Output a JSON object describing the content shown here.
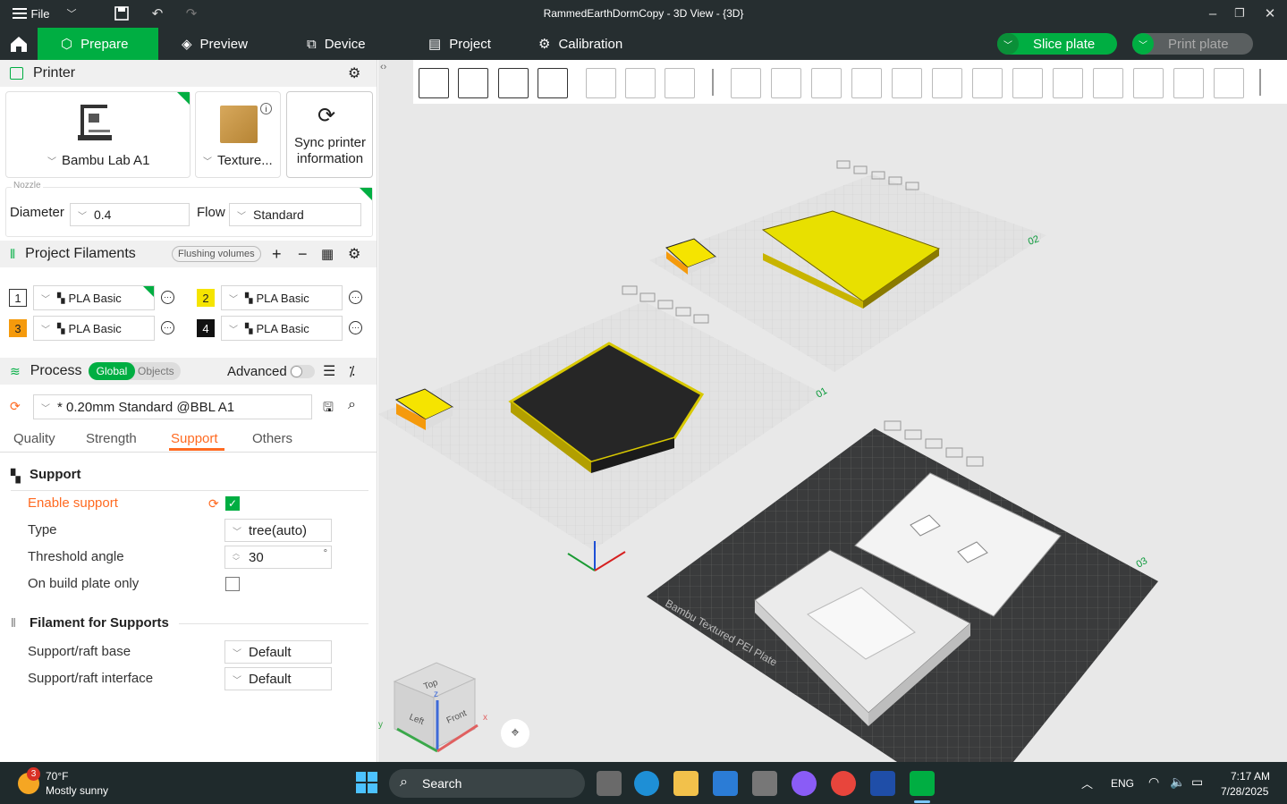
{
  "window": {
    "title": "RammedEarthDormCopy - 3D View - {3D}",
    "menu_label": "File"
  },
  "tabs": [
    {
      "label": "Prepare",
      "icon": "cube-icon",
      "active": true
    },
    {
      "label": "Preview",
      "icon": "layers-icon"
    },
    {
      "label": "Device",
      "icon": "device-icon"
    },
    {
      "label": "Project",
      "icon": "project-icon"
    },
    {
      "label": "Calibration",
      "icon": "calibration-icon"
    }
  ],
  "actions": {
    "slice": "Slice plate",
    "print": "Print plate"
  },
  "printer": {
    "section": "Printer",
    "name": "Bambu Lab A1",
    "plate": "Texture...",
    "sync": "Sync printer information",
    "nozzle_legend": "Nozzle",
    "diameter_label": "Diameter",
    "diameter_value": "0.4",
    "flow_label": "Flow",
    "flow_value": "Standard"
  },
  "filaments": {
    "section": "Project Filaments",
    "flushing": "Flushing volumes",
    "items": [
      {
        "num": "1",
        "name": "PLA Basic",
        "color": "#ffffff"
      },
      {
        "num": "2",
        "name": "PLA Basic",
        "color": "#f5e400"
      },
      {
        "num": "3",
        "name": "PLA Basic",
        "color": "#f59a0c"
      },
      {
        "num": "4",
        "name": "PLA Basic",
        "color": "#111111"
      }
    ]
  },
  "process": {
    "section": "Process",
    "global": "Global",
    "objects": "Objects",
    "advanced": "Advanced",
    "preset": "* 0.20mm Standard @BBL A1",
    "subtabs": [
      "Quality",
      "Strength",
      "Support",
      "Others"
    ],
    "active_subtab": "Support"
  },
  "support": {
    "title": "Support",
    "enable_label": "Enable support",
    "enable_checked": true,
    "type_label": "Type",
    "type_value": "tree(auto)",
    "threshold_label": "Threshold angle",
    "threshold_value": "30",
    "threshold_unit": "°",
    "build_plate_label": "On build plate only",
    "build_plate_checked": false,
    "filament_title": "Filament for Supports",
    "base_label": "Support/raft base",
    "base_value": "Default",
    "interface_label": "Support/raft interface",
    "interface_value": "Default"
  },
  "viewport": {
    "plate_labels": [
      "02",
      "01",
      "03"
    ],
    "cube_labels": {
      "top": "Top",
      "left": "Left",
      "front": "Front"
    },
    "axis_labels": {
      "x": "x",
      "y": "y",
      "z": "z"
    },
    "plate_text": "Bambu Textured PEI Plate",
    "plate_number": "03"
  },
  "taskbar": {
    "weather_temp": "70°F",
    "weather_desc": "Mostly sunny",
    "weather_badge": "3",
    "search": "Search",
    "lang": "ENG",
    "time": "7:17 AM",
    "date": "7/28/2025"
  },
  "colors": {
    "accent": "#00ae42",
    "orange": "#ff6a21",
    "yellow": "#f5e400"
  }
}
